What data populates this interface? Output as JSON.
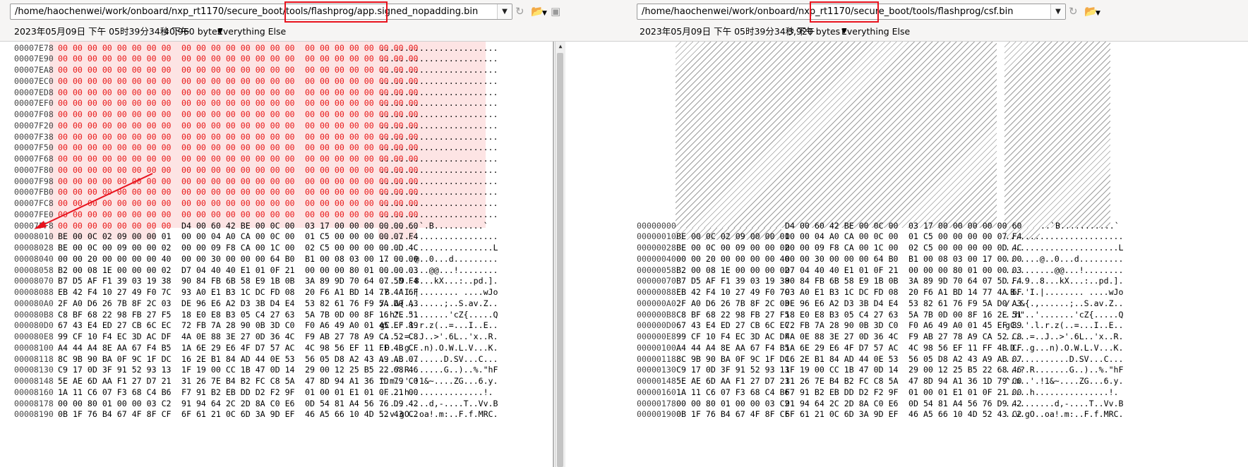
{
  "left": {
    "path": "/home/haochenwei/work/onboard/nxp_rt1170/secure_boot/tools/flashprog/app.signed_nopadding.bin",
    "date": "2023年05月09日 下午 05时39分34秒 下午",
    "size": "40,960 bytes",
    "filter": "Everything Else",
    "rows": [
      {
        "a": "00007E78",
        "g1": "00 00 00 00 00 00 00 00",
        "g2": "00 00 00 00 00 00 00 00",
        "g3": "00 00 00 00 00 00 00 00",
        "t": "........................"
      },
      {
        "a": "00007E90",
        "g1": "00 00 00 00 00 00 00 00",
        "g2": "00 00 00 00 00 00 00 00",
        "g3": "00 00 00 00 00 00 00 00",
        "t": "........................"
      },
      {
        "a": "00007EA8",
        "g1": "00 00 00 00 00 00 00 00",
        "g2": "00 00 00 00 00 00 00 00",
        "g3": "00 00 00 00 00 00 00 00",
        "t": "........................"
      },
      {
        "a": "00007EC0",
        "g1": "00 00 00 00 00 00 00 00",
        "g2": "00 00 00 00 00 00 00 00",
        "g3": "00 00 00 00 00 00 00 00",
        "t": "........................"
      },
      {
        "a": "00007ED8",
        "g1": "00 00 00 00 00 00 00 00",
        "g2": "00 00 00 00 00 00 00 00",
        "g3": "00 00 00 00 00 00 00 00",
        "t": "........................"
      },
      {
        "a": "00007EF0",
        "g1": "00 00 00 00 00 00 00 00",
        "g2": "00 00 00 00 00 00 00 00",
        "g3": "00 00 00 00 00 00 00 00",
        "t": "........................"
      },
      {
        "a": "00007F08",
        "g1": "00 00 00 00 00 00 00 00",
        "g2": "00 00 00 00 00 00 00 00",
        "g3": "00 00 00 00 00 00 00 00",
        "t": "........................"
      },
      {
        "a": "00007F20",
        "g1": "00 00 00 00 00 00 00 00",
        "g2": "00 00 00 00 00 00 00 00",
        "g3": "00 00 00 00 00 00 00 00",
        "t": "........................"
      },
      {
        "a": "00007F38",
        "g1": "00 00 00 00 00 00 00 00",
        "g2": "00 00 00 00 00 00 00 00",
        "g3": "00 00 00 00 00 00 00 00",
        "t": "........................"
      },
      {
        "a": "00007F50",
        "g1": "00 00 00 00 00 00 00 00",
        "g2": "00 00 00 00 00 00 00 00",
        "g3": "00 00 00 00 00 00 00 00",
        "t": "........................"
      },
      {
        "a": "00007F68",
        "g1": "00 00 00 00 00 00 00 00",
        "g2": "00 00 00 00 00 00 00 00",
        "g3": "00 00 00 00 00 00 00 00",
        "t": "........................"
      },
      {
        "a": "00007F80",
        "g1": "00 00 00 00 00 00 00 00",
        "g2": "00 00 00 00 00 00 00 00",
        "g3": "00 00 00 00 00 00 00 00",
        "t": "........................"
      },
      {
        "a": "00007F98",
        "g1": "00 00 00 00 00 00 00 00",
        "g2": "00 00 00 00 00 00 00 00",
        "g3": "00 00 00 00 00 00 00 00",
        "t": "........................"
      },
      {
        "a": "00007FB0",
        "g1": "00 00 00 00 00 00 00 00",
        "g2": "00 00 00 00 00 00 00 00",
        "g3": "00 00 00 00 00 00 00 00",
        "t": "........................"
      },
      {
        "a": "00007FC8",
        "g1": "00 00 00 00 00 00 00 00",
        "g2": "00 00 00 00 00 00 00 00",
        "g3": "00 00 00 00 00 00 00 00",
        "t": "........................"
      },
      {
        "a": "00007FE0",
        "g1": "00 00 00 00 00 00 00 00",
        "g2": "00 00 00 00 00 00 00 00",
        "g3": "00 00 00 00 00 00 00 00",
        "t": "........................"
      },
      {
        "a": "00007FF8",
        "g1": "00 00 00 00 00 00 00 00",
        "g2": "D4 00 60 42 BE 00 0C 00",
        "g3": "03 17 00 00 00 00 00 60",
        "t": "........`.B..........`",
        "red": "partial"
      },
      {
        "a": "00008010",
        "g1": "BE 00 0C 02 09 00 00 01",
        "g2": "00 00 04 A0 CA 00 0C 00",
        "g3": "01 C5 00 00 00 00 07 F4",
        "t": "........................"
      },
      {
        "a": "00008028",
        "g1": "BE 00 0C 00 09 00 00 02",
        "g2": "00 00 09 F8 CA 00 1C 00",
        "g3": "02 C5 00 00 00 00 0D 4C",
        "t": ".......................L"
      },
      {
        "a": "00008040",
        "g1": "00 00 20 00 00 00 00 40",
        "g2": "00 00 30 00 00 00 64 B0",
        "g3": "B1 00 08 03 00 17 00 00",
        "t": ".. ....@..0...d........."
      },
      {
        "a": "00008058",
        "g1": "B2 00 08 1E 00 00 00 02",
        "g2": "D7 04 40 40 E1 01 0F 21",
        "g3": "00 00 00 80 01 00 00 03",
        "t": "..........@@...!........"
      },
      {
        "a": "00008070",
        "g1": "B7 D5 AF F1 39 03 19 38",
        "g2": "90 84 FB 6B 58 E9 1B 0B",
        "g3": "3A 89 9D 70 64 07 5D F4",
        "t": "....9..8...kX...:..pd.]."
      },
      {
        "a": "00008088",
        "g1": "EB 42 F4 10 27 49 F0 7C",
        "g2": "93 A0 E1 B3 1C DC FD 08",
        "g3": "20 F6 A1 BD 14 77 4A 6F",
        "t": ".B..'I.|........ ....wJo"
      },
      {
        "a": "000080A0",
        "g1": "2F A0 D6 26 7B 8F 2C 03",
        "g2": "DE 96 E6 A2 D3 3B D4 E4",
        "g3": "53 82 61 76 F9 5A D0 A3",
        "t": "/..&{.,......;..S.av.Z.."
      },
      {
        "a": "000080B8",
        "g1": "C8 BF 68 22 98 FB 27 F5",
        "g2": "18 E0 E8 B3 05 C4 27 63",
        "g3": "5A 7B 0D 00 8F 16 2E 51",
        "t": "..h\"..'.......'cZ{.....Q"
      },
      {
        "a": "000080D0",
        "g1": "67 43 E4 ED 27 CB 6C EC",
        "g2": "72 FB 7A 28 90 0B 3D C0",
        "g3": "F0 A6 49 A0 01 45 EF 89",
        "t": "gC..'.l.r.z(..=...I..E.."
      },
      {
        "a": "000080E8",
        "g1": "99 CF 10 F4 EC 3D AC DF",
        "g2": "4A 0E 88 3E 27 0D 36 4C",
        "g3": "F9 AB 27 78 A9 CA 52 C8",
        "t": ".....=..J..>'.6L..'x..R."
      },
      {
        "a": "00008100",
        "g1": "A4 44 A4 8E AA 67 F4 B5",
        "g2": "1A 6E 29 E6 4F D7 57 AC",
        "g3": "4C 98 56 EF 11 FF 4B CF",
        "t": ".D...g...n).O.W.L.V...K."
      },
      {
        "a": "00008118",
        "g1": "8C 9B 90 BA 0F 9C 1F DC",
        "g2": "16 2E B1 84 AD 44 0E 53",
        "g3": "56 05 D8 A2 43 A9 AB 07",
        "t": ".............D.SV...C..."
      },
      {
        "a": "00008130",
        "g1": "C9 17 0D 3F 91 52 93 13",
        "g2": "1F 19 00 CC 1B 47 0D 14",
        "g3": "29 00 12 25 B5 22 68 46",
        "t": "...?.R.......G..)..%.\"hF"
      },
      {
        "a": "00008148",
        "g1": "5E AE 6D AA F1 27 D7 21",
        "g2": "31 26 7E B4 B2 FC C8 5A",
        "g3": "47 8D 94 A1 36 1D 79 C0",
        "t": "^.m..'.!1&~....ZG...6.y."
      },
      {
        "a": "00008160",
        "g1": "1A 11 C6 07 F3 68 C4 B6",
        "g2": "F7 91 B2 EB DD D2 F2 9F",
        "g3": "01 00 01 E1 01 0F 21 00",
        "t": ".....h...............!."
      },
      {
        "a": "00008178",
        "g1": "00 00 80 01 00 00 03 C2",
        "g2": "91 94 64 2C 2D 8A C0 E6",
        "g3": "0D 54 81 A4 56 76 D9 42",
        "t": "..........d,-....T..Vv.B"
      },
      {
        "a": "00008190",
        "g1": "0B 1F 76 B4 67 4F 8F CF",
        "g2": "6F 61 21 0C 6D 3A 9D EF",
        "g3": "46 A5 66 10 4D 52 43 C2",
        "t": "..v.gO..oa!.m:..F.f.MRC."
      }
    ]
  },
  "right": {
    "path": "/home/haochenwei/work/onboard/nxp_rt1170/secure_boot/tools/flashprog/csf.bin",
    "date": "2023年05月09日 下午 05时39分34秒 下午",
    "size": "3,920 bytes",
    "filter": "Everything Else",
    "first_row": {
      "a": "00000000",
      "g2": "D4 00 60 42 BE 00 0C 00",
      "g3": "03 17 00 00 00 00 00 60",
      "t": "..`B...........`"
    },
    "addrs": [
      "00000010",
      "00000028",
      "00000040",
      "00000058",
      "00000070",
      "00000088",
      "000000A0",
      "000000B8",
      "000000D0",
      "000000E8",
      "00000100",
      "00000118",
      "00000130",
      "00000148",
      "00000160",
      "00000178",
      "00000190"
    ]
  },
  "colors": {
    "highlight_border": "#e8131e",
    "diff_red": "#e81717",
    "diff_band": "#fde4e4"
  }
}
